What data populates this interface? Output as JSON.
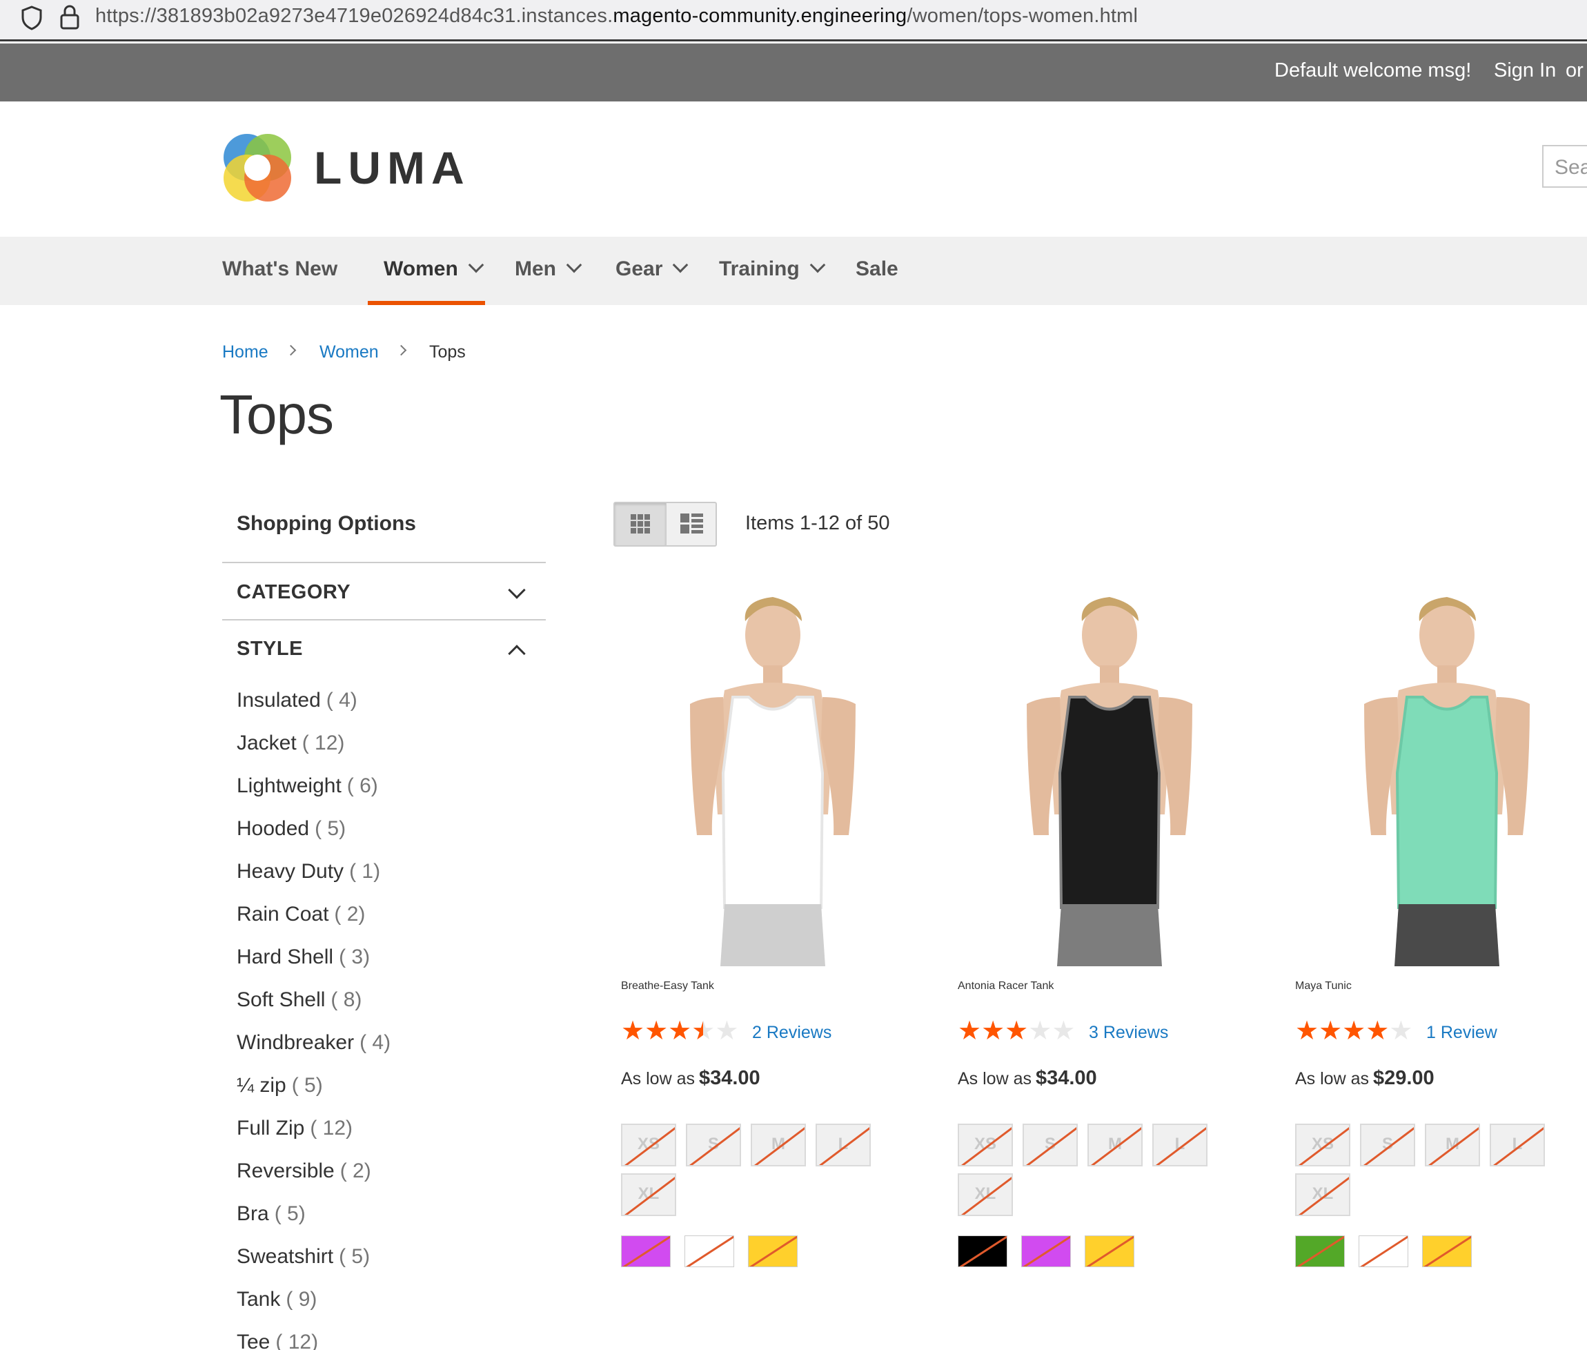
{
  "browser": {
    "url_prefix": "https://381893b02a9273e4719e026924d84c31.instances.",
    "url_domain": "magento-community.engineering",
    "url_path": "/women/tops-women.html"
  },
  "top_panel": {
    "welcome": "Default welcome msg!",
    "sign_in": "Sign In",
    "or": "or"
  },
  "header": {
    "logo_text": "LUMA",
    "search_placeholder": "Search entire store here..."
  },
  "nav": {
    "items": [
      {
        "label": "What's New"
      },
      {
        "label": "Women"
      },
      {
        "label": "Men"
      },
      {
        "label": "Gear"
      },
      {
        "label": "Training"
      },
      {
        "label": "Sale"
      }
    ]
  },
  "breadcrumb": {
    "home": "Home",
    "women": "Women",
    "current": "Tops"
  },
  "page_title": "Tops",
  "sidebar": {
    "title": "Shopping Options",
    "category": "CATEGORY",
    "style": "STYLE",
    "style_options": [
      {
        "label": "Insulated",
        "count": "( 4)"
      },
      {
        "label": "Jacket",
        "count": "( 12)"
      },
      {
        "label": "Lightweight",
        "count": "( 6)"
      },
      {
        "label": "Hooded",
        "count": "( 5)"
      },
      {
        "label": "Heavy Duty",
        "count": "( 1)"
      },
      {
        "label": "Rain Coat",
        "count": "( 2)"
      },
      {
        "label": "Hard Shell",
        "count": "( 3)"
      },
      {
        "label": "Soft Shell",
        "count": "( 8)"
      },
      {
        "label": "Windbreaker",
        "count": "( 4)"
      },
      {
        "label": "¼ zip",
        "count": "( 5)"
      },
      {
        "label": "Full Zip",
        "count": "( 12)"
      },
      {
        "label": "Reversible",
        "count": "( 2)"
      },
      {
        "label": "Bra",
        "count": "( 5)"
      },
      {
        "label": "Sweatshirt",
        "count": "( 5)"
      },
      {
        "label": "Tank",
        "count": "( 9)"
      },
      {
        "label": "Tee",
        "count": "( 12)"
      }
    ]
  },
  "toolbar": {
    "items": "Items 1-12 of 50"
  },
  "products": [
    {
      "name": "Breathe-Easy Tank",
      "rating": 3.5,
      "reviews_count": "2",
      "reviews_word": "Reviews",
      "price_label": "As low as",
      "price": "$34.00",
      "sizes": [
        "XS",
        "S",
        "M",
        "L",
        "XL"
      ],
      "colors": [
        "#d14bf0",
        "#ffffff",
        "#ffd02c"
      ]
    },
    {
      "name": "Antonia Racer Tank",
      "rating": 3,
      "reviews_count": "3",
      "reviews_word": "Reviews",
      "price_label": "As low as",
      "price": "$34.00",
      "sizes": [
        "XS",
        "S",
        "M",
        "L",
        "XL"
      ],
      "colors": [
        "#000000",
        "#d14bf0",
        "#ffd02c"
      ]
    },
    {
      "name": "Maya Tunic",
      "rating": 4,
      "reviews_count": "1",
      "reviews_word": "Review",
      "price_label": "As low as",
      "price": "$29.00",
      "sizes": [
        "XS",
        "S",
        "M",
        "L",
        "XL"
      ],
      "colors": [
        "#53a828",
        "#ffffff",
        "#ffd02c"
      ]
    }
  ],
  "colors": {
    "accent": "#eb5202",
    "link": "#1979c3",
    "top_panel": "#6e6e6e",
    "star": "#ff5501"
  }
}
